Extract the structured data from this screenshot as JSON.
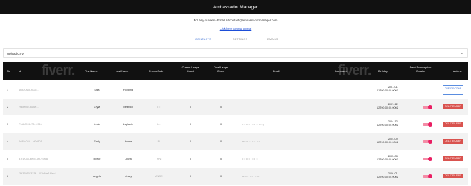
{
  "app": {
    "title": "Ambassador Manager"
  },
  "contact": {
    "text": "For any queries - Email at contact@ambassadormanager.com",
    "tutorial_link": "Click here to view tutorial"
  },
  "tabs": [
    {
      "label": "CONTACTS",
      "active": true
    },
    {
      "label": "SETTINGS",
      "active": false
    },
    {
      "label": "EMAILS",
      "active": false
    }
  ],
  "upload": {
    "label": "Upload CSV",
    "icon": "chevron-down-icon"
  },
  "table": {
    "headers": {
      "no": "No",
      "id": "Id",
      "first_name": "First Name",
      "last_name": "Last Name",
      "promo_code": "Promo Code",
      "current_usage": "Current Usage Count",
      "total_usage": "Total Usage Count",
      "email": "Email",
      "username": "Username",
      "birthday": "Birthday",
      "send_sub": "Send Subscription Emails",
      "actions": "Actions"
    },
    "watermark": "fiverr.",
    "rows": [
      {
        "no": "1",
        "id": "4b820a8d-f825...",
        "first": "Lisa",
        "last": "Hopping",
        "promo": "",
        "current": "",
        "total": "",
        "email": "",
        "birthday": "2007-01-01T00:00:00.000Z",
        "action": "CREATE CODE"
      },
      {
        "no": "2",
        "id": "7fd8ebcf-f6a6e-...",
        "first": "Leyla",
        "last": "Beardot",
        "promo": "• • •",
        "current": "0",
        "total": "0",
        "email": "",
        "birthday": "2007-12-12T00:00:00.000Z",
        "action": "DELETE USER"
      },
      {
        "no": "3",
        "id": "77db0996-73...2014",
        "first": "Lexie",
        "last": "Laplante",
        "promo": "L• •",
        "current": "0",
        "total": "0",
        "email": "• • • • • • • • • • • • g",
        "birthday": "2004-12-12T00:00:00.000Z",
        "action": "DELETE USER"
      },
      {
        "no": "4",
        "id": "2e85c024-...d0d801",
        "first": "Emily",
        "last": "Ihome",
        "promo": "EL",
        "current": "0",
        "total": "0",
        "email": "e• • • • • • • • • •",
        "birthday": "2004-09-12T00:00:00.000Z",
        "action": "DELETE USER"
      },
      {
        "no": "5",
        "id": "d1f1f058-ae7b-4f97-9afa",
        "first": "Reece",
        "last": "Olivia",
        "promo": "RN•",
        "current": "0",
        "total": "0",
        "email": "• • • • • • • • • •",
        "birthday": "2005-08-12T00:00:00.000Z",
        "action": "DELETE USER"
      },
      {
        "no": "6",
        "id": "f3d37050-3234-...02b40e1f0ec1",
        "first": "Angela",
        "last": "Irizary",
        "promo": "ANGE•",
        "current": "0",
        "total": "0",
        "email": "a.m• • • • • • • •",
        "birthday": "2006-01-12T00:00:00.000Z",
        "action": "DELETE USER"
      }
    ]
  },
  "colors": {
    "appbar": "#111111",
    "tab_active": "#3b6fd4",
    "delete": "#d9534f",
    "toggle": "#e91e63"
  }
}
